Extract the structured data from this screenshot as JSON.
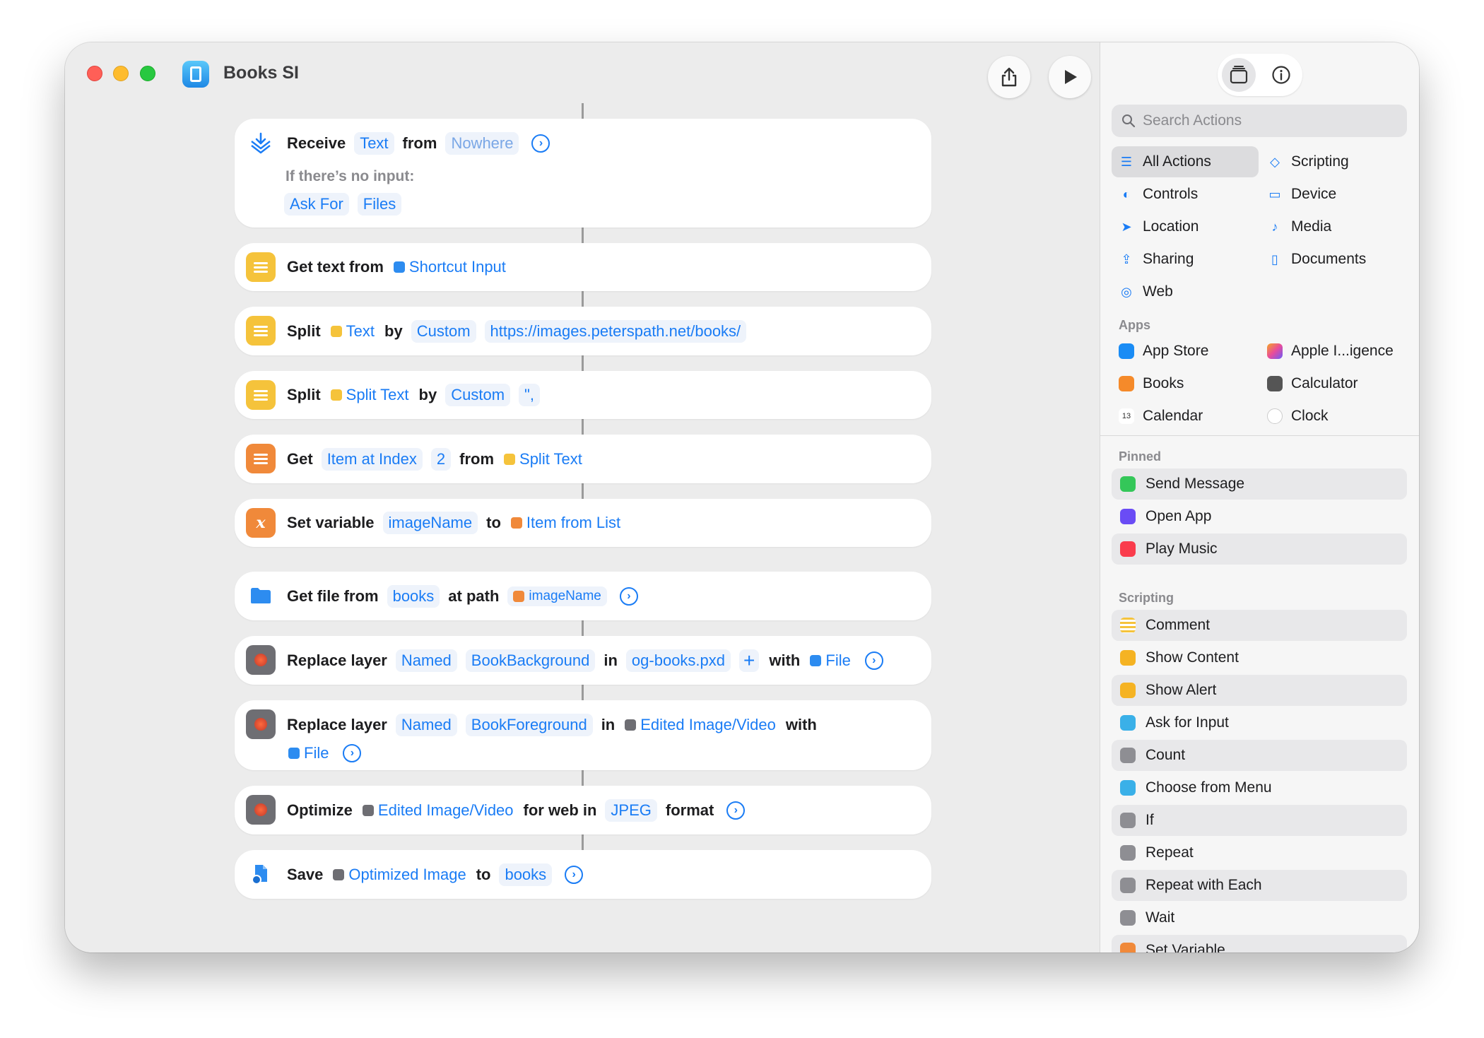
{
  "window": {
    "title": "Books SI"
  },
  "actions": {
    "receive": {
      "verb": "Receive",
      "type": "Text",
      "from": "from",
      "source": "Nowhere",
      "no_input_label": "If there’s no input:",
      "ask_for": "Ask For",
      "files": "Files"
    },
    "get_text": {
      "verb": "Get text from",
      "input": "Shortcut Input"
    },
    "split1": {
      "verb": "Split",
      "input": "Text",
      "by": "by",
      "mode": "Custom",
      "value": "https://images.peterspath.net/books/"
    },
    "split2": {
      "verb": "Split",
      "input": "Split Text",
      "by": "by",
      "mode": "Custom",
      "value": "\","
    },
    "get_item": {
      "verb": "Get",
      "mode": "Item at Index",
      "index": "2",
      "from": "from",
      "input": "Split Text"
    },
    "set_var": {
      "verb": "Set variable",
      "name": "imageName",
      "to": "to",
      "input": "Item from List"
    },
    "get_file": {
      "verb": "Get file from",
      "folder": "books",
      "at_path": "at path",
      "path": "imageName"
    },
    "replace1": {
      "verb": "Replace layer",
      "mode": "Named",
      "layer": "BookBackground",
      "in": "in",
      "doc": "og-books.pxd",
      "with": "with",
      "input": "File"
    },
    "replace2": {
      "verb": "Replace layer",
      "mode": "Named",
      "layer": "BookForeground",
      "in": "in",
      "doc": "Edited Image/Video",
      "with": "with",
      "input": "File"
    },
    "optimize": {
      "verb": "Optimize",
      "input": "Edited Image/Video",
      "for_web": "for web in",
      "format": "JPEG",
      "format_label": "format"
    },
    "save": {
      "verb": "Save",
      "input": "Optimized Image",
      "to": "to",
      "folder": "books"
    }
  },
  "sidebar": {
    "search_placeholder": "Search Actions",
    "categories": [
      "All Actions",
      "Scripting",
      "Controls",
      "Device",
      "Location",
      "Media",
      "Sharing",
      "Documents",
      "Web"
    ],
    "apps_label": "Apps",
    "apps": [
      "App Store",
      "Apple I...igence",
      "Books",
      "Calculator",
      "Calendar",
      "Clock"
    ],
    "calendar_day": "13",
    "pinned_label": "Pinned",
    "pinned": [
      "Send Message",
      "Open App",
      "Play Music"
    ],
    "scripting_label": "Scripting",
    "scripting": [
      "Comment",
      "Show Content",
      "Show Alert",
      "Ask for Input",
      "Count",
      "Choose from Menu",
      "If",
      "Repeat",
      "Repeat with Each",
      "Wait",
      "Set Variable"
    ]
  }
}
